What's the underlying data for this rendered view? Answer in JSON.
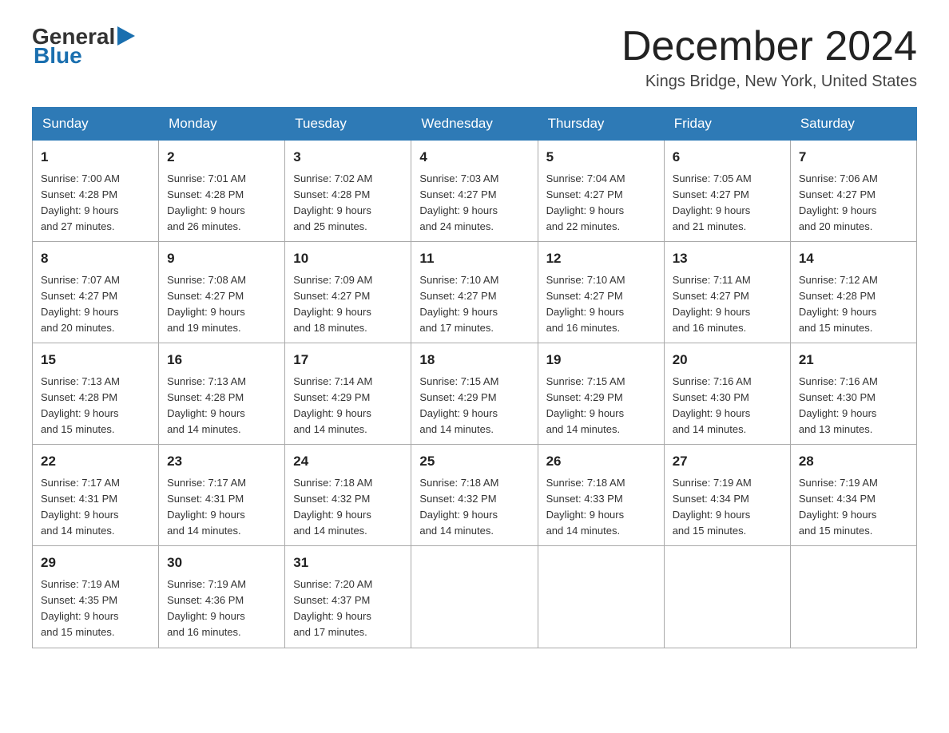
{
  "header": {
    "logo_general": "General",
    "logo_blue": "Blue",
    "month_title": "December 2024",
    "location": "Kings Bridge, New York, United States"
  },
  "days_of_week": [
    "Sunday",
    "Monday",
    "Tuesday",
    "Wednesday",
    "Thursday",
    "Friday",
    "Saturday"
  ],
  "weeks": [
    [
      {
        "day": "1",
        "sunrise": "7:00 AM",
        "sunset": "4:28 PM",
        "daylight": "9 hours and 27 minutes."
      },
      {
        "day": "2",
        "sunrise": "7:01 AM",
        "sunset": "4:28 PM",
        "daylight": "9 hours and 26 minutes."
      },
      {
        "day": "3",
        "sunrise": "7:02 AM",
        "sunset": "4:28 PM",
        "daylight": "9 hours and 25 minutes."
      },
      {
        "day": "4",
        "sunrise": "7:03 AM",
        "sunset": "4:27 PM",
        "daylight": "9 hours and 24 minutes."
      },
      {
        "day": "5",
        "sunrise": "7:04 AM",
        "sunset": "4:27 PM",
        "daylight": "9 hours and 22 minutes."
      },
      {
        "day": "6",
        "sunrise": "7:05 AM",
        "sunset": "4:27 PM",
        "daylight": "9 hours and 21 minutes."
      },
      {
        "day": "7",
        "sunrise": "7:06 AM",
        "sunset": "4:27 PM",
        "daylight": "9 hours and 20 minutes."
      }
    ],
    [
      {
        "day": "8",
        "sunrise": "7:07 AM",
        "sunset": "4:27 PM",
        "daylight": "9 hours and 20 minutes."
      },
      {
        "day": "9",
        "sunrise": "7:08 AM",
        "sunset": "4:27 PM",
        "daylight": "9 hours and 19 minutes."
      },
      {
        "day": "10",
        "sunrise": "7:09 AM",
        "sunset": "4:27 PM",
        "daylight": "9 hours and 18 minutes."
      },
      {
        "day": "11",
        "sunrise": "7:10 AM",
        "sunset": "4:27 PM",
        "daylight": "9 hours and 17 minutes."
      },
      {
        "day": "12",
        "sunrise": "7:10 AM",
        "sunset": "4:27 PM",
        "daylight": "9 hours and 16 minutes."
      },
      {
        "day": "13",
        "sunrise": "7:11 AM",
        "sunset": "4:27 PM",
        "daylight": "9 hours and 16 minutes."
      },
      {
        "day": "14",
        "sunrise": "7:12 AM",
        "sunset": "4:28 PM",
        "daylight": "9 hours and 15 minutes."
      }
    ],
    [
      {
        "day": "15",
        "sunrise": "7:13 AM",
        "sunset": "4:28 PM",
        "daylight": "9 hours and 15 minutes."
      },
      {
        "day": "16",
        "sunrise": "7:13 AM",
        "sunset": "4:28 PM",
        "daylight": "9 hours and 14 minutes."
      },
      {
        "day": "17",
        "sunrise": "7:14 AM",
        "sunset": "4:29 PM",
        "daylight": "9 hours and 14 minutes."
      },
      {
        "day": "18",
        "sunrise": "7:15 AM",
        "sunset": "4:29 PM",
        "daylight": "9 hours and 14 minutes."
      },
      {
        "day": "19",
        "sunrise": "7:15 AM",
        "sunset": "4:29 PM",
        "daylight": "9 hours and 14 minutes."
      },
      {
        "day": "20",
        "sunrise": "7:16 AM",
        "sunset": "4:30 PM",
        "daylight": "9 hours and 14 minutes."
      },
      {
        "day": "21",
        "sunrise": "7:16 AM",
        "sunset": "4:30 PM",
        "daylight": "9 hours and 13 minutes."
      }
    ],
    [
      {
        "day": "22",
        "sunrise": "7:17 AM",
        "sunset": "4:31 PM",
        "daylight": "9 hours and 14 minutes."
      },
      {
        "day": "23",
        "sunrise": "7:17 AM",
        "sunset": "4:31 PM",
        "daylight": "9 hours and 14 minutes."
      },
      {
        "day": "24",
        "sunrise": "7:18 AM",
        "sunset": "4:32 PM",
        "daylight": "9 hours and 14 minutes."
      },
      {
        "day": "25",
        "sunrise": "7:18 AM",
        "sunset": "4:32 PM",
        "daylight": "9 hours and 14 minutes."
      },
      {
        "day": "26",
        "sunrise": "7:18 AM",
        "sunset": "4:33 PM",
        "daylight": "9 hours and 14 minutes."
      },
      {
        "day": "27",
        "sunrise": "7:19 AM",
        "sunset": "4:34 PM",
        "daylight": "9 hours and 15 minutes."
      },
      {
        "day": "28",
        "sunrise": "7:19 AM",
        "sunset": "4:34 PM",
        "daylight": "9 hours and 15 minutes."
      }
    ],
    [
      {
        "day": "29",
        "sunrise": "7:19 AM",
        "sunset": "4:35 PM",
        "daylight": "9 hours and 15 minutes."
      },
      {
        "day": "30",
        "sunrise": "7:19 AM",
        "sunset": "4:36 PM",
        "daylight": "9 hours and 16 minutes."
      },
      {
        "day": "31",
        "sunrise": "7:20 AM",
        "sunset": "4:37 PM",
        "daylight": "9 hours and 17 minutes."
      },
      null,
      null,
      null,
      null
    ]
  ],
  "labels": {
    "sunrise": "Sunrise:",
    "sunset": "Sunset:",
    "daylight": "Daylight:"
  }
}
